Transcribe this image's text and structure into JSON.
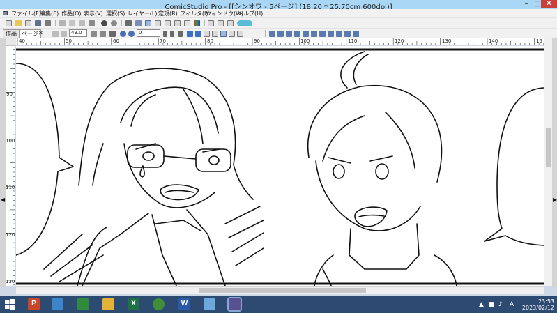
{
  "window": {
    "title": "ComicStudio Pro - [[シンオワ - 5ページ] (18.20 * 25.70cm 600dpi)]",
    "minimize": "–",
    "restore": "□",
    "close": "✕"
  },
  "menu": [
    "ファイル(F)",
    "編集(E)",
    "作品(O)",
    "表示(V)",
    "選択(S)",
    "レイヤー(L)",
    "定規(R)",
    "フィルタ(I)",
    "ウィンドウ(W)",
    "ヘルプ(H)"
  ],
  "toolbar": {
    "zoom_value": "49.0",
    "angle_value": "0",
    "sakuhin_label": "作品",
    "page_tab_label": "ページ",
    "tab_close": "✕"
  },
  "ruler": {
    "top_labels": [
      "40",
      "50",
      "60",
      "70",
      "80",
      "90",
      "100",
      "110",
      "120",
      "130",
      "140",
      "15"
    ],
    "left_labels": [
      "90",
      "100",
      "110",
      "120",
      "130"
    ]
  },
  "taskbar": {
    "time": "23:53",
    "date": "2023/02/12",
    "ime": "A",
    "apps": [
      {
        "name": "windows-start",
        "color": "#2d4a72",
        "glyph": ""
      },
      {
        "name": "powerpoint",
        "color": "#c8472b",
        "glyph": "P"
      },
      {
        "name": "paint",
        "color": "#3a86c8",
        "glyph": ""
      },
      {
        "name": "excel-store",
        "color": "#2f8a3e",
        "glyph": ""
      },
      {
        "name": "file-explorer",
        "color": "#e2b338",
        "glyph": ""
      },
      {
        "name": "excel",
        "color": "#1e7244",
        "glyph": "X"
      },
      {
        "name": "chrome",
        "color": "#3f8f3a",
        "glyph": ""
      },
      {
        "name": "word",
        "color": "#2a5aa8",
        "glyph": "W"
      },
      {
        "name": "monitor-app",
        "color": "#6aa9d9",
        "glyph": ""
      },
      {
        "name": "comicstudio",
        "color": "#5a4f8f",
        "glyph": ""
      }
    ]
  },
  "colors": {
    "titlebar": "#a9d6f5",
    "taskbar": "#2d4a72",
    "close": "#c9403a"
  }
}
